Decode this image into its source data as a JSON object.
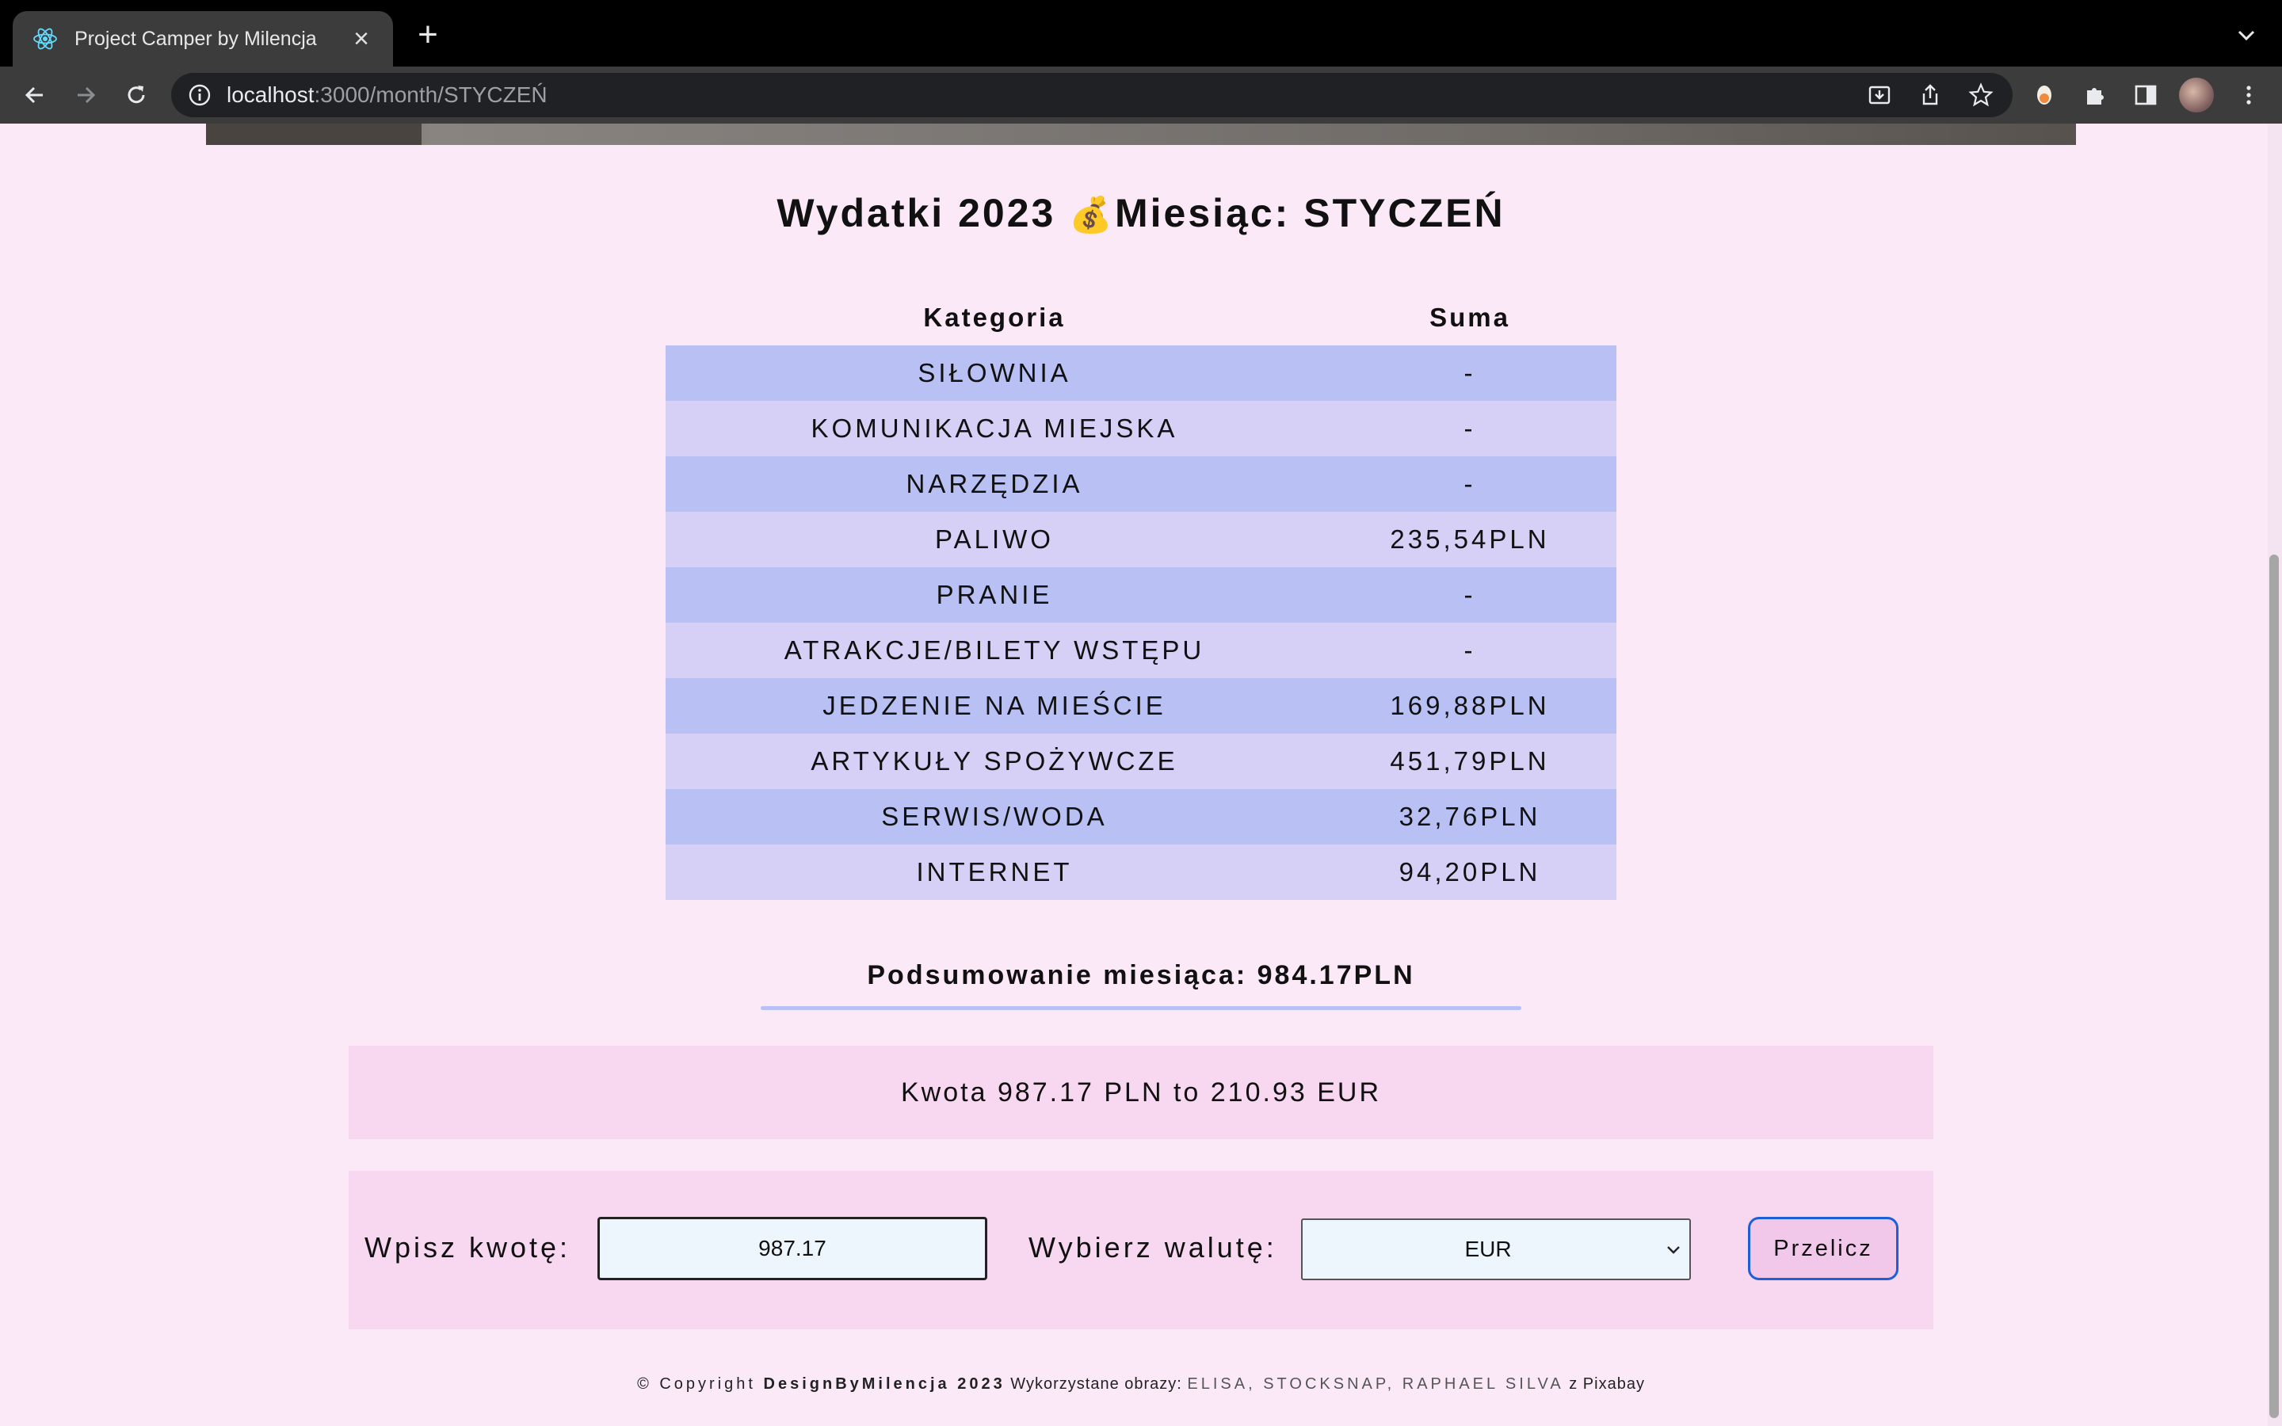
{
  "browser": {
    "tab_title": "Project Camper by Milencja",
    "url_host": "localhost",
    "url_path": ":3000/month/STYCZEŃ"
  },
  "page": {
    "heading_prefix": "Wydatki 2023 ",
    "heading_emoji": "💰",
    "heading_suffix": "Miesiąc: STYCZEŃ",
    "table": {
      "headers": [
        "Kategoria",
        "Suma"
      ],
      "rows": [
        {
          "category": "SIŁOWNIA",
          "sum": "-"
        },
        {
          "category": "KOMUNIKACJA MIEJSKA",
          "sum": "-"
        },
        {
          "category": "NARZĘDZIA",
          "sum": "-"
        },
        {
          "category": "PALIWO",
          "sum": "235,54PLN"
        },
        {
          "category": "PRANIE",
          "sum": "-"
        },
        {
          "category": "ATRAKCJE/BILETY WSTĘPU",
          "sum": "-"
        },
        {
          "category": "JEDZENIE NA MIEŚCIE",
          "sum": "169,88PLN"
        },
        {
          "category": "ARTYKUŁY SPOŻYWCZE",
          "sum": "451,79PLN"
        },
        {
          "category": "SERWIS/WODA",
          "sum": "32,76PLN"
        },
        {
          "category": "INTERNET",
          "sum": "94,20PLN"
        }
      ]
    },
    "summary": "Podsumowanie miesiąca: 984.17PLN",
    "conversion_result": "Kwota 987.17 PLN to 210.93 EUR",
    "converter": {
      "amount_label": "Wpisz kwotę:",
      "amount_value": "987.17",
      "currency_label": "Wybierz walutę:",
      "currency_value": "EUR",
      "button_label": "Przelicz"
    },
    "footer": {
      "copyright": "© Copyright ",
      "brand": "DesignByMilencja 2023",
      "images_label": " Wykorzystane obrazy: ",
      "credits": "ELISA, STOCKSNAP, RAPHAEL SILVA",
      "source": " z Pixabay"
    }
  },
  "colors": {
    "page_bg": "#fbe9f8",
    "row_odd": "#b8c0f4",
    "row_even": "#d6d0f6",
    "panel_bg": "#f8d8f1",
    "button_border": "#1f5fd6"
  }
}
